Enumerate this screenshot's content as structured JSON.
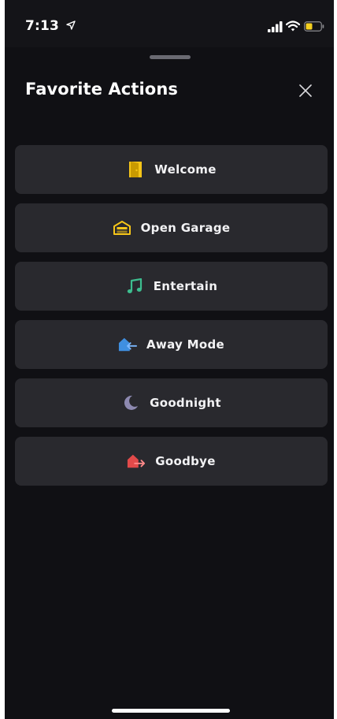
{
  "status_bar": {
    "time": "7:13",
    "icons": [
      "location-arrow-icon",
      "signal-icon",
      "wifi-icon",
      "battery-icon"
    ],
    "battery_color": "#f5d020"
  },
  "sheet": {
    "title": "Favorite Actions",
    "close_icon": "close-icon"
  },
  "actions": [
    {
      "label": "Welcome",
      "icon": "door-icon",
      "color": "#f5c518"
    },
    {
      "label": "Open Garage",
      "icon": "garage-icon",
      "color": "#f5c518"
    },
    {
      "label": "Entertain",
      "icon": "music-note-icon",
      "color": "#3dbd8f"
    },
    {
      "label": "Away Mode",
      "icon": "home-arrow-left-icon",
      "color": "#3f8fe0"
    },
    {
      "label": "Goodnight",
      "icon": "moon-icon",
      "color": "#8d89b0"
    },
    {
      "label": "Goodbye",
      "icon": "home-arrow-right-icon",
      "color": "#e24a4a"
    }
  ]
}
